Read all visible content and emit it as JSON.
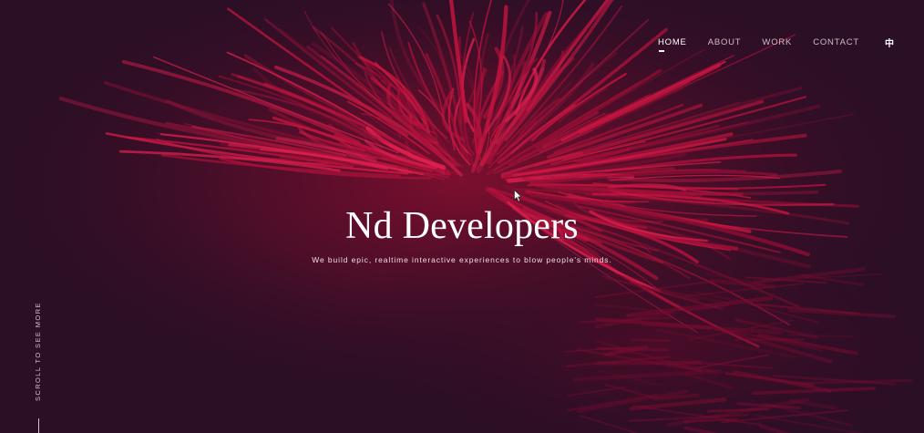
{
  "page": {
    "title": "Nd Developers",
    "subtitle": "We build epic, realtime interactive experiences to blow people's minds."
  },
  "nav": {
    "items": [
      {
        "label": "HOME",
        "active": true
      },
      {
        "label": "ABOUT",
        "active": false
      },
      {
        "label": "WORK",
        "active": false
      },
      {
        "label": "CONTACT",
        "active": false
      }
    ],
    "language_toggle": "中"
  },
  "scroll_hint": {
    "label": "SCROLL TO SEE MORE"
  },
  "colors": {
    "background": "#2a0f25",
    "accent": "#c8143f",
    "text": "#ffffff"
  },
  "icons": {
    "cursor": "arrow-cursor-icon"
  }
}
